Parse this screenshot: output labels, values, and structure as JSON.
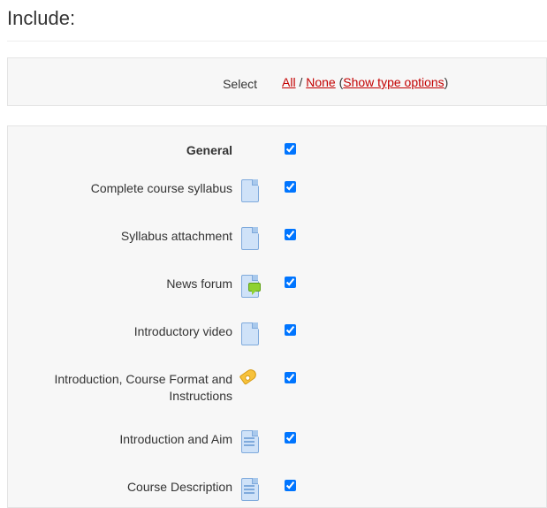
{
  "heading": "Include:",
  "select_row": {
    "label": "Select",
    "all": "All",
    "none": "None",
    "show_type": "Show type options"
  },
  "items": [
    {
      "label": "General",
      "icon": null,
      "bold": true,
      "checked": true
    },
    {
      "label": "Complete course syllabus",
      "icon": "file",
      "bold": false,
      "checked": true
    },
    {
      "label": "Syllabus attachment",
      "icon": "file",
      "bold": false,
      "checked": true
    },
    {
      "label": "News forum",
      "icon": "forum",
      "bold": false,
      "checked": true
    },
    {
      "label": "Introductory video",
      "icon": "file",
      "bold": false,
      "checked": true
    },
    {
      "label": "Introduction, Course Format and Instructions",
      "icon": "tag",
      "bold": false,
      "checked": true
    },
    {
      "label": "Introduction and Aim",
      "icon": "page",
      "bold": false,
      "checked": true
    },
    {
      "label": "Course Description",
      "icon": "page",
      "bold": false,
      "checked": true
    }
  ]
}
